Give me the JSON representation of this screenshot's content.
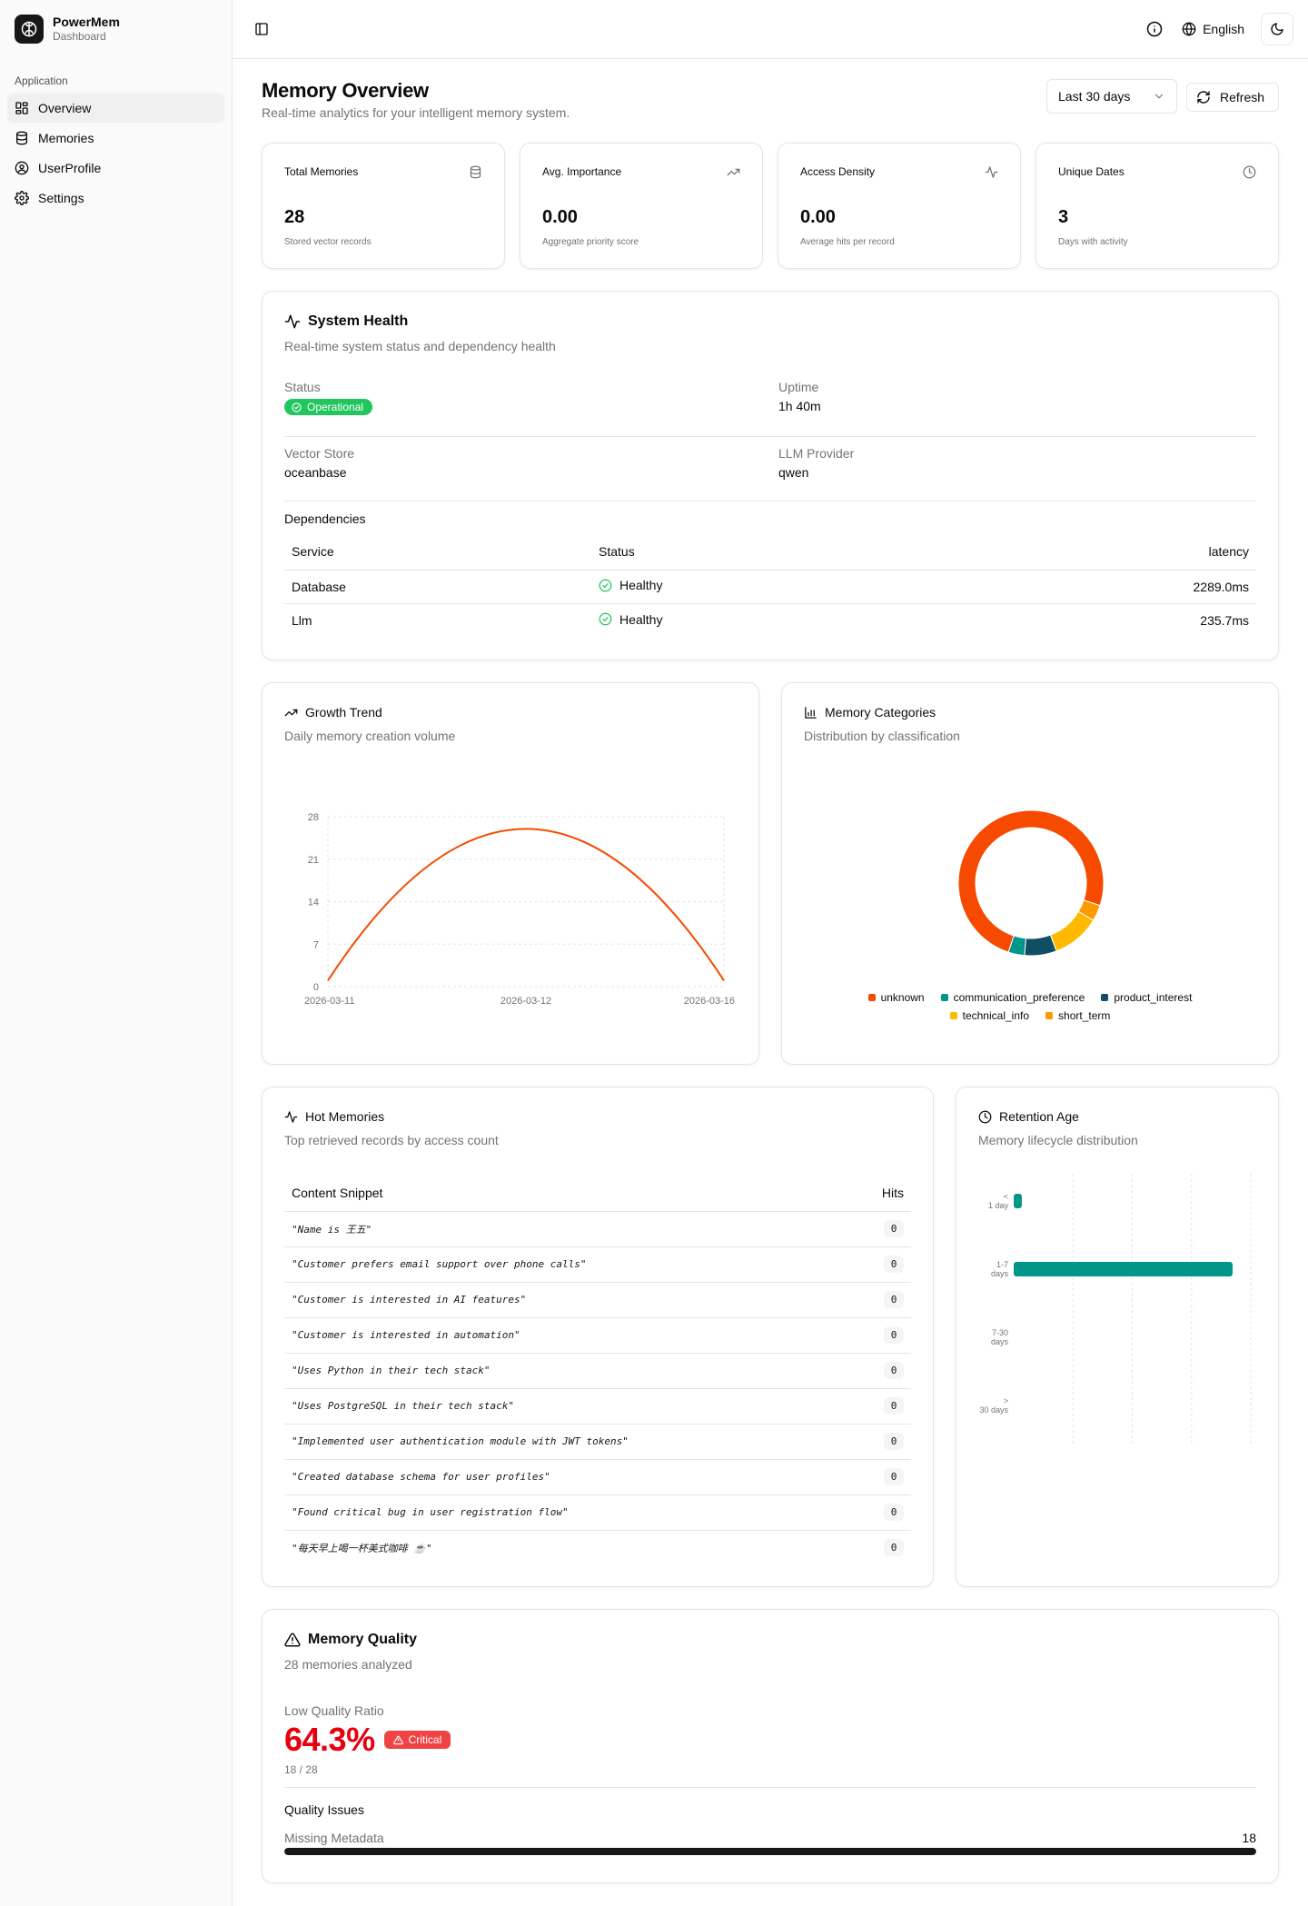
{
  "app": {
    "name": "PowerMem",
    "subtitle": "Dashboard"
  },
  "sidebar": {
    "group_label": "Application",
    "items": [
      {
        "label": "Overview",
        "icon": "grid-icon",
        "active": true
      },
      {
        "label": "Memories",
        "icon": "database-icon",
        "active": false
      },
      {
        "label": "UserProfile",
        "icon": "user-circle-icon",
        "active": false
      },
      {
        "label": "Settings",
        "icon": "gear-icon",
        "active": false
      }
    ]
  },
  "header": {
    "language": "English"
  },
  "page": {
    "title": "Memory Overview",
    "subtitle": "Real-time analytics for your intelligent memory system.",
    "range": "Last 30 days",
    "refresh_label": "Refresh"
  },
  "stats": [
    {
      "title": "Total Memories",
      "value": "28",
      "desc": "Stored vector records",
      "icon": "database-icon"
    },
    {
      "title": "Avg. Importance",
      "value": "0.00",
      "desc": "Aggregate priority score",
      "icon": "trending-up-icon"
    },
    {
      "title": "Access Density",
      "value": "0.00",
      "desc": "Average hits per record",
      "icon": "activity-icon"
    },
    {
      "title": "Unique Dates",
      "value": "3",
      "desc": "Days with activity",
      "icon": "clock-icon"
    }
  ],
  "health": {
    "title": "System Health",
    "subtitle": "Real-time system status and dependency health",
    "status_label": "Status",
    "status_value": "Operational",
    "uptime_label": "Uptime",
    "uptime_value": "1h 40m",
    "vector_label": "Vector Store",
    "vector_value": "oceanbase",
    "llm_label": "LLM Provider",
    "llm_value": "qwen",
    "deps_title": "Dependencies",
    "deps_headers": [
      "Service",
      "Status",
      "latency"
    ],
    "deps": [
      {
        "service": "Database",
        "status": "Healthy",
        "latency": "2289.0ms"
      },
      {
        "service": "Llm",
        "status": "Healthy",
        "latency": "235.7ms"
      }
    ]
  },
  "growth": {
    "title": "Growth Trend",
    "subtitle": "Daily memory creation volume"
  },
  "categories": {
    "title": "Memory Categories",
    "subtitle": "Distribution by classification"
  },
  "hot": {
    "title": "Hot Memories",
    "subtitle": "Top retrieved records by access count",
    "col_content": "Content Snippet",
    "col_hits": "Hits",
    "rows": [
      {
        "content": "\"Name is 王五\"",
        "hits": "0"
      },
      {
        "content": "\"Customer prefers email support over phone calls\"",
        "hits": "0"
      },
      {
        "content": "\"Customer is interested in AI features\"",
        "hits": "0"
      },
      {
        "content": "\"Customer is interested in automation\"",
        "hits": "0"
      },
      {
        "content": "\"Uses Python in their tech stack\"",
        "hits": "0"
      },
      {
        "content": "\"Uses PostgreSQL in their tech stack\"",
        "hits": "0"
      },
      {
        "content": "\"Implemented user authentication module with JWT tokens\"",
        "hits": "0"
      },
      {
        "content": "\"Created database schema for user profiles\"",
        "hits": "0"
      },
      {
        "content": "\"Found critical bug in user registration flow\"",
        "hits": "0"
      },
      {
        "content": "\"每天早上喝一杯美式咖啡 ☕\"",
        "hits": "0"
      }
    ]
  },
  "retention": {
    "title": "Retention Age",
    "subtitle": "Memory lifecycle distribution"
  },
  "quality": {
    "title": "Memory Quality",
    "subtitle": "28 memories analyzed",
    "ratio_label": "Low Quality Ratio",
    "ratio_value": "64.3%",
    "badge": "Critical",
    "fraction": "18 / 28",
    "issues_title": "Quality Issues",
    "issue_label": "Missing Metadata",
    "issue_count": "18",
    "issue_fill": 1.0
  },
  "colors": {
    "accent_orange": "#f54a00",
    "teal": "#009689",
    "navy": "#104e64",
    "amber": "#ffb900",
    "orange2": "#fe9a00",
    "green": "#22c55e",
    "red": "#e7000b"
  },
  "chart_data": [
    {
      "type": "line",
      "x": [
        "2026-03-11",
        "2026-03-12",
        "2026-03-16"
      ],
      "series": [
        {
          "values": [
            1,
            26,
            1
          ]
        }
      ],
      "xticks": [
        "2026-03-11",
        "2026-03-12",
        "2026-03-16"
      ],
      "yticks": [
        "0",
        "7",
        "14",
        "21",
        "28"
      ],
      "ylim": [
        0,
        28
      ],
      "grid": true
    },
    {
      "type": "pie",
      "donut": true,
      "labels": [
        "unknown",
        "communication_preference",
        "product_interest",
        "technical_info",
        "short_term"
      ],
      "values": [
        21,
        1,
        2,
        3,
        1
      ],
      "colors": [
        "#f54a00",
        "#009689",
        "#104e64",
        "#ffb900",
        "#fe9a00"
      ],
      "legend": "bottom"
    },
    {
      "type": "bar",
      "orientation": "horizontal",
      "categories": [
        "< 1 day",
        "1-7 days",
        "7-30 days",
        "> 30 days"
      ],
      "values": [
        1,
        27,
        0,
        0
      ],
      "color": "#009689",
      "grid": true
    }
  ]
}
